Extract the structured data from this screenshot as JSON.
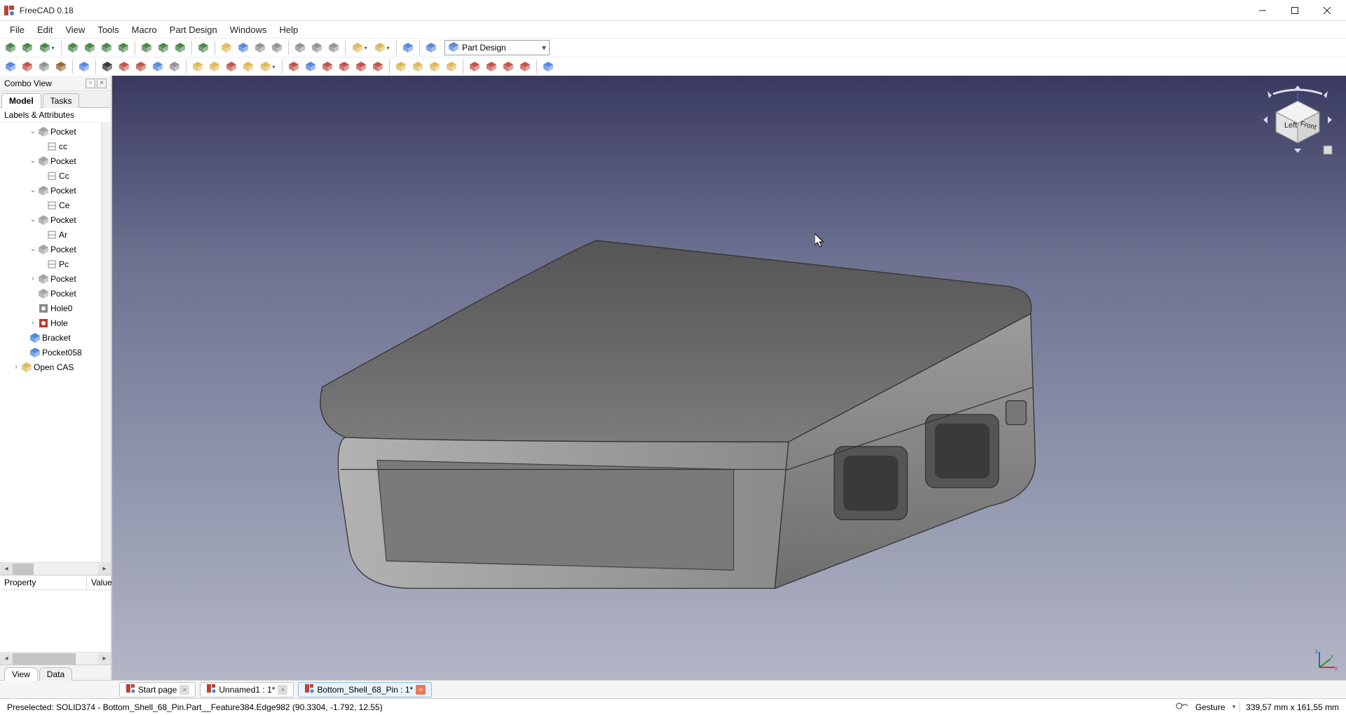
{
  "window": {
    "title": "FreeCAD 0.18"
  },
  "menubar": [
    "File",
    "Edit",
    "View",
    "Tools",
    "Macro",
    "Part Design",
    "Windows",
    "Help"
  ],
  "workbench": {
    "selected": "Part Design"
  },
  "combo": {
    "title": "Combo View",
    "tabs": {
      "model": "Model",
      "tasks": "Tasks"
    },
    "labels_header": "Labels & Attributes",
    "tree": [
      {
        "indent": 3,
        "tw": "v",
        "icon": "feature-gray",
        "label": "Pocket"
      },
      {
        "indent": 4,
        "tw": "",
        "icon": "sketch",
        "label": "cc"
      },
      {
        "indent": 3,
        "tw": "v",
        "icon": "feature-gray",
        "label": "Pocket"
      },
      {
        "indent": 4,
        "tw": "",
        "icon": "sketch",
        "label": "Cc"
      },
      {
        "indent": 3,
        "tw": "v",
        "icon": "feature-gray",
        "label": "Pocket"
      },
      {
        "indent": 4,
        "tw": "",
        "icon": "sketch",
        "label": "Ce"
      },
      {
        "indent": 3,
        "tw": "v",
        "icon": "feature-gray",
        "label": "Pocket"
      },
      {
        "indent": 4,
        "tw": "",
        "icon": "sketch",
        "label": "Ar"
      },
      {
        "indent": 3,
        "tw": "v",
        "icon": "feature-gray",
        "label": "Pocket"
      },
      {
        "indent": 4,
        "tw": "",
        "icon": "sketch",
        "label": "Pc"
      },
      {
        "indent": 3,
        "tw": ">",
        "icon": "feature-gray",
        "label": "Pocket"
      },
      {
        "indent": 3,
        "tw": "",
        "icon": "feature-gray",
        "label": "Pocket"
      },
      {
        "indent": 3,
        "tw": "",
        "icon": "hole-gray",
        "label": "Hole0"
      },
      {
        "indent": 3,
        "tw": ">",
        "icon": "hole-red",
        "label": "Hole"
      },
      {
        "indent": 2,
        "tw": "",
        "icon": "cube-blue",
        "label": "Bracket"
      },
      {
        "indent": 2,
        "tw": "",
        "icon": "cube-blue",
        "label": "Pocket058"
      },
      {
        "indent": 1,
        "tw": ">",
        "icon": "cube-yellow",
        "label": "Open CAS"
      }
    ]
  },
  "property": {
    "col1": "Property",
    "col2": "Value",
    "tabs": {
      "view": "View",
      "data": "Data"
    }
  },
  "doctabs": [
    {
      "label": "Start page",
      "active": false,
      "close": "gray"
    },
    {
      "label": "Unnamed1 : 1*",
      "active": false,
      "close": "gray"
    },
    {
      "label": "Bottom_Shell_68_Pin : 1*",
      "active": true,
      "close": "red"
    }
  ],
  "status": {
    "preselect": "Preselected: SOLID374 - Bottom_Shell_68_Pin.Part__Feature384.Edge982 (90.3304, -1.792, 12.55)",
    "navstyle": "Gesture",
    "dims": "339,57 mm x 161,55 mm"
  },
  "navcube": {
    "left": "Left",
    "front": "Front"
  },
  "icons": {
    "row1": [
      {
        "c": "#3a7a3a"
      },
      {
        "c": "#3a7a3a"
      },
      {
        "c": "#3a7a3a",
        "drop": true
      },
      {
        "sep": true
      },
      {
        "c": "#3a7a3a"
      },
      {
        "c": "#3a7a3a"
      },
      {
        "c": "#3a7a3a"
      },
      {
        "c": "#3a7a3a"
      },
      {
        "sep": true
      },
      {
        "c": "#3a7a3a"
      },
      {
        "c": "#3a7a3a"
      },
      {
        "c": "#3a7a3a"
      },
      {
        "sep": true
      },
      {
        "c": "#3a7a3a"
      },
      {
        "sep": true
      },
      {
        "c": "#d9b24a"
      },
      {
        "c": "#4a7bd9"
      },
      {
        "c": "#888"
      },
      {
        "c": "#888"
      },
      {
        "sep": true
      },
      {
        "c": "#888"
      },
      {
        "c": "#888"
      },
      {
        "c": "#888"
      },
      {
        "sep": true
      },
      {
        "c": "#d9b24a",
        "drop": true
      },
      {
        "c": "#d9b24a",
        "drop": true
      },
      {
        "sep": true
      },
      {
        "c": "#4a7bd9"
      },
      {
        "sep": true
      },
      {
        "c": "#4a7bd9"
      }
    ],
    "row2": [
      {
        "c": "#4a7bd9"
      },
      {
        "c": "#b9443a"
      },
      {
        "c": "#888"
      },
      {
        "c": "#8a5a2a"
      },
      {
        "sep": true
      },
      {
        "c": "#4a7bd9"
      },
      {
        "sep": true
      },
      {
        "c": "#222"
      },
      {
        "c": "#b9443a"
      },
      {
        "c": "#b9443a"
      },
      {
        "c": "#4a7bd9"
      },
      {
        "c": "#888"
      },
      {
        "sep": true
      },
      {
        "c": "#d9b24a"
      },
      {
        "c": "#d9b24a"
      },
      {
        "c": "#b9443a"
      },
      {
        "c": "#d9b24a"
      },
      {
        "c": "#d9b24a",
        "drop": true
      },
      {
        "sep": true
      },
      {
        "c": "#b9443a"
      },
      {
        "c": "#4a7bd9"
      },
      {
        "c": "#b9443a"
      },
      {
        "c": "#b9443a"
      },
      {
        "c": "#b9443a"
      },
      {
        "c": "#b9443a"
      },
      {
        "sep": true
      },
      {
        "c": "#d9b24a"
      },
      {
        "c": "#d9b24a"
      },
      {
        "c": "#d9b24a"
      },
      {
        "c": "#d9b24a"
      },
      {
        "sep": true
      },
      {
        "c": "#b9443a"
      },
      {
        "c": "#b9443a"
      },
      {
        "c": "#b9443a"
      },
      {
        "c": "#b9443a"
      },
      {
        "sep": true
      },
      {
        "c": "#4a7bd9"
      }
    ]
  }
}
